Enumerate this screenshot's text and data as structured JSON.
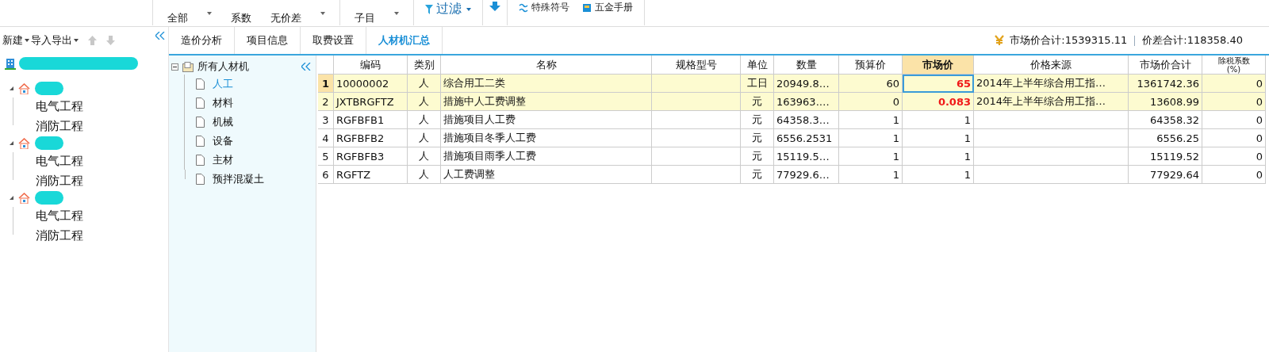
{
  "toolbar": {
    "items": [
      {
        "kind": "label",
        "label": "全部"
      },
      {
        "kind": "caret"
      },
      {
        "kind": "label",
        "label": "系数"
      },
      {
        "kind": "label",
        "label": "无价差"
      },
      {
        "kind": "caret"
      },
      {
        "kind": "label",
        "label": "子目"
      },
      {
        "kind": "caret"
      }
    ],
    "filter": {
      "label": "过滤"
    },
    "tools": [
      {
        "label": "特殊符号",
        "kind": "symbol"
      },
      {
        "label": "五金手册",
        "kind": "book"
      }
    ]
  },
  "left_panel": {
    "actions": [
      {
        "label": "新建",
        "caret": true
      },
      {
        "label": "导入导出",
        "caret": true
      }
    ],
    "projects": [
      {
        "expanded": true,
        "children": [
          "电气工程",
          "消防工程"
        ]
      },
      {
        "expanded": true,
        "children": [
          "电气工程",
          "消防工程"
        ]
      },
      {
        "expanded": true,
        "children": [
          "电气工程",
          "消防工程"
        ]
      }
    ]
  },
  "tabs": [
    {
      "label": "造价分析",
      "selected": false
    },
    {
      "label": "项目信息",
      "selected": false
    },
    {
      "label": "取费设置",
      "selected": false
    },
    {
      "label": "人材机汇总",
      "selected": true
    }
  ],
  "summary": {
    "market_total": "市场价合计:1539315.11",
    "difference_total": "价差合计:118358.40"
  },
  "category_tree": {
    "label": "所有人材机",
    "expanded": true,
    "children": [
      {
        "label": "人工",
        "selected": true
      },
      {
        "label": "材料",
        "selected": false
      },
      {
        "label": "机械",
        "selected": false
      },
      {
        "label": "设备",
        "selected": false
      },
      {
        "label": "主材",
        "selected": false
      },
      {
        "label": "预拌混凝土",
        "selected": false
      }
    ]
  },
  "table": {
    "columns": [
      {
        "label": "编码",
        "selected": false
      },
      {
        "label": "类别",
        "selected": false
      },
      {
        "label": "名称",
        "selected": false
      },
      {
        "label": "规格型号",
        "selected": false
      },
      {
        "label": "单位",
        "selected": false
      },
      {
        "label": "数量",
        "selected": false
      },
      {
        "label": "预算价",
        "selected": false
      },
      {
        "label": "市场价",
        "selected": true
      },
      {
        "label": "价格来源",
        "selected": false
      },
      {
        "label": "市场价合计",
        "selected": false
      },
      {
        "label": "除税系数",
        "sublabel": "(%)",
        "selected": false
      }
    ],
    "rows": [
      {
        "no": "1",
        "selected": true,
        "highlighted": true,
        "price_changed": true,
        "code": "10000002",
        "category": "人",
        "name": "综合用工二类",
        "unit": "工日",
        "quantity": "20949.8…",
        "budget_price": "60",
        "market_price": "65",
        "price_source": "2014年上半年综合用工指…",
        "market_total": "1361742.36",
        "tax_factor": "0"
      },
      {
        "no": "2",
        "selected": false,
        "highlighted": true,
        "price_changed": true,
        "code": "JXTBRGFTZ",
        "category": "人",
        "name": "措施中人工费调整",
        "unit": "元",
        "quantity": "163963.…",
        "budget_price": "0",
        "market_price": "0.083",
        "price_source": "2014年上半年综合用工指…",
        "market_total": "13608.99",
        "tax_factor": "0"
      },
      {
        "no": "3",
        "selected": false,
        "highlighted": false,
        "price_changed": false,
        "code": "RGFBFB1",
        "category": "人",
        "name": "措施项目人工费",
        "unit": "元",
        "quantity": "64358.3…",
        "budget_price": "1",
        "market_price": "1",
        "market_total": "64358.32",
        "tax_factor": "0"
      },
      {
        "no": "4",
        "selected": false,
        "highlighted": false,
        "price_changed": false,
        "code": "RGFBFB2",
        "category": "人",
        "name": "措施项目冬季人工费",
        "unit": "元",
        "quantity": "6556.2531",
        "budget_price": "1",
        "market_price": "1",
        "market_total": "6556.25",
        "tax_factor": "0"
      },
      {
        "no": "5",
        "selected": false,
        "highlighted": false,
        "price_changed": false,
        "code": "RGFBFB3",
        "category": "人",
        "name": "措施项目雨季人工费",
        "unit": "元",
        "quantity": "15119.5…",
        "budget_price": "1",
        "market_price": "1",
        "market_total": "15119.52",
        "tax_factor": "0"
      },
      {
        "no": "6",
        "selected": false,
        "highlighted": false,
        "price_changed": false,
        "code": "RGFTZ",
        "category": "人",
        "name": "人工费调整",
        "unit": "元",
        "quantity": "77929.6…",
        "budget_price": "1",
        "market_price": "1",
        "market_total": "77929.64",
        "tax_factor": "0"
      }
    ]
  }
}
